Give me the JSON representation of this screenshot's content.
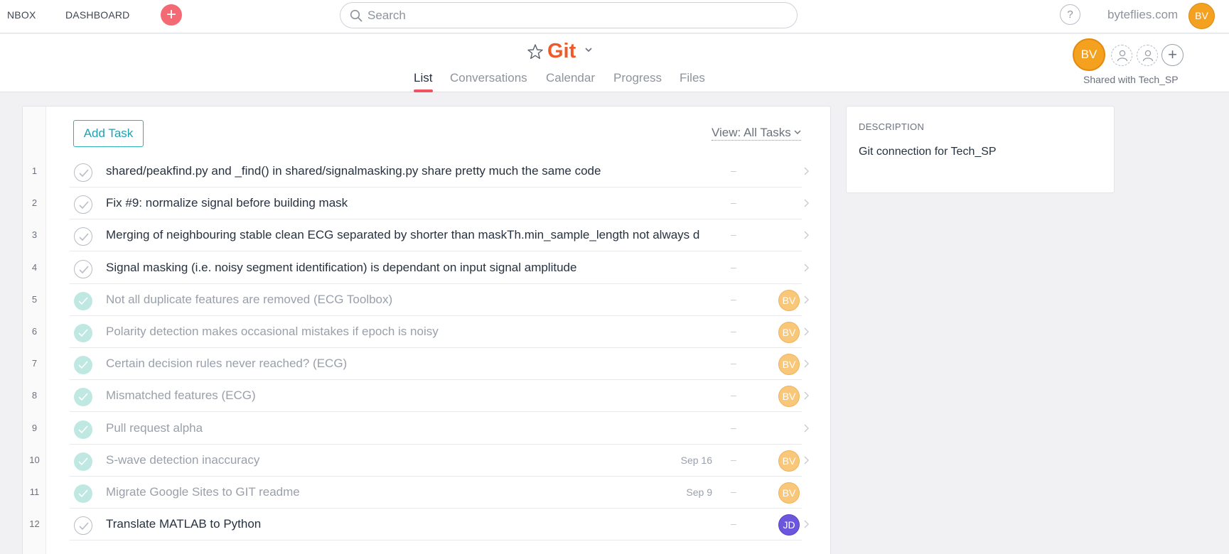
{
  "topnav": {
    "inbox": "NBOX",
    "dashboard": "DASHBOARD",
    "add_icon": "plus-circle-icon",
    "search_placeholder": "Search",
    "help": "?",
    "org": "byteflies.com",
    "user_initials": "BV"
  },
  "project": {
    "title": "Git",
    "tabs": [
      "List",
      "Conversations",
      "Calendar",
      "Progress",
      "Files"
    ],
    "active_tab": "List",
    "owner_initials": "BV",
    "shared_with": "Shared with Tech_SP"
  },
  "task_list": {
    "add_task": "Add Task",
    "view_filter": "View: All Tasks",
    "tasks": [
      {
        "num": "1",
        "title": "shared/peakfind.py and _find() in shared/signalmasking.py share pretty much the same code",
        "done": false,
        "due": "",
        "dash": "–",
        "assignee": ""
      },
      {
        "num": "2",
        "title": "Fix #9: normalize signal before building mask",
        "done": false,
        "due": "",
        "dash": "–",
        "assignee": ""
      },
      {
        "num": "3",
        "title": "Merging of neighbouring stable clean ECG separated by shorter than maskTh.min_sample_length not always d",
        "done": false,
        "due": "",
        "dash": "–",
        "assignee": ""
      },
      {
        "num": "4",
        "title": "Signal masking (i.e. noisy segment identification) is dependant on input signal amplitude",
        "done": false,
        "due": "",
        "dash": "–",
        "assignee": ""
      },
      {
        "num": "5",
        "title": "Not all duplicate features are removed (ECG Toolbox)",
        "done": true,
        "due": "",
        "dash": "–",
        "assignee": "BV"
      },
      {
        "num": "6",
        "title": "Polarity detection makes occasional mistakes if epoch is noisy",
        "done": true,
        "due": "",
        "dash": "–",
        "assignee": "BV"
      },
      {
        "num": "7",
        "title": "Certain decision rules never reached? (ECG)",
        "done": true,
        "due": "",
        "dash": "–",
        "assignee": "BV"
      },
      {
        "num": "8",
        "title": "Mismatched features (ECG)",
        "done": true,
        "due": "",
        "dash": "–",
        "assignee": "BV"
      },
      {
        "num": "9",
        "title": "Pull request alpha",
        "done": true,
        "due": "",
        "dash": "–",
        "assignee": ""
      },
      {
        "num": "10",
        "title": "S-wave detection inaccuracy",
        "done": true,
        "due": "Sep 16",
        "dash": "–",
        "assignee": "BV"
      },
      {
        "num": "11",
        "title": "Migrate Google Sites to GIT readme",
        "done": true,
        "due": "Sep 9",
        "dash": "–",
        "assignee": "BV"
      },
      {
        "num": "12",
        "title": "Translate MATLAB to Python",
        "done": false,
        "due": "",
        "dash": "–",
        "assignee": "JD"
      }
    ]
  },
  "description": {
    "label": "DESCRIPTION",
    "text": "Git connection for Tech_SP"
  },
  "colors": {
    "accent_title": "#ef5a2a",
    "tab_underline": "#f05260",
    "add_button": "#f46a74",
    "add_task_border": "#2fb1b8",
    "avatar_bv": "#f4a11f",
    "avatar_jd": "#6b56dd",
    "done_check": "#bfe8e2"
  }
}
